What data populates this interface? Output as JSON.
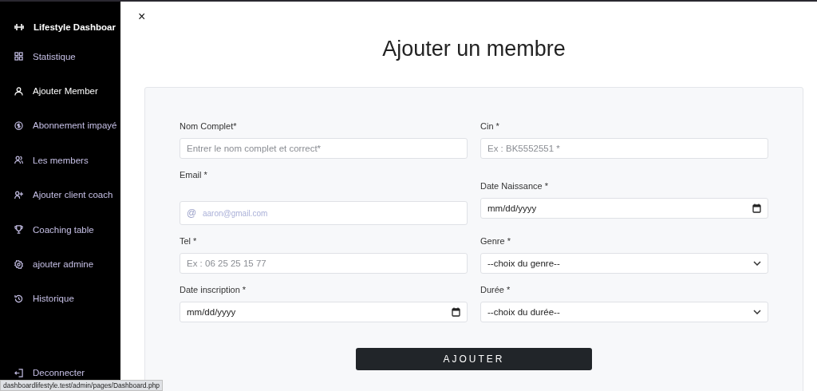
{
  "sidebar": {
    "brand": "Lifestyle Dashboar",
    "items": [
      {
        "label": "Statistique",
        "selected": false
      },
      {
        "label": "Ajouter Member",
        "selected": true
      },
      {
        "label": "Abonnement impayé",
        "selected": false
      },
      {
        "label": "Les members",
        "selected": false
      },
      {
        "label": "Ajouter client coach",
        "selected": false
      },
      {
        "label": "Coaching table",
        "selected": false
      },
      {
        "label": "ajouter admine",
        "selected": false
      },
      {
        "label": "Historique",
        "selected": false
      }
    ],
    "logout": "Deconnecter"
  },
  "close": "×",
  "title": "Ajouter un membre",
  "fields": [
    {
      "label": "Nom Complet*",
      "kind": "text",
      "placeholder": "Entrer le nom complet et correct*"
    },
    {
      "label": "Cin *",
      "kind": "text",
      "placeholder": "Ex : BK5552551 *"
    },
    {
      "label": "Email *",
      "kind": "email",
      "prefix": "@",
      "placeholder": "aaron@gmail.com"
    },
    {
      "label": "Date Naissance *",
      "kind": "date",
      "value": "mm/dd/yyyy"
    },
    {
      "label": "Tel *",
      "kind": "text",
      "placeholder": "Ex : 06 25 25 15 77"
    },
    {
      "label": "Genre *",
      "kind": "select",
      "value": "--choix du genre--"
    },
    {
      "label": "Date inscription *",
      "kind": "date",
      "value": "mm/dd/yyyy"
    },
    {
      "label": "Durée *",
      "kind": "select",
      "value": "--choix du durée--"
    }
  ],
  "submit": "AJOUTER",
  "status_bar": "dashboardlifestyle.test/admin/pages/Dashboard.php"
}
